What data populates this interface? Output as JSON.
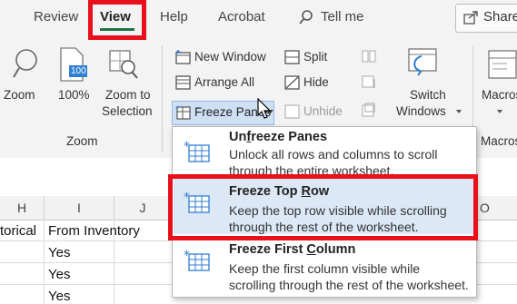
{
  "tabs": [
    {
      "label": "Review"
    },
    {
      "label": "View"
    },
    {
      "label": "Help"
    },
    {
      "label": "Acrobat"
    },
    {
      "label": "Tell me"
    }
  ],
  "share_label": "Share",
  "zoom_group": {
    "zoom": "Zoom",
    "hundred": "100%",
    "zoom_to_line1": "Zoom to",
    "zoom_to_line2": "Selection",
    "group_label": "Zoom",
    "icon_badge": "100"
  },
  "window_group": {
    "new_window": "New Window",
    "arrange_all": "Arrange All",
    "freeze_panes": "Freeze Panes",
    "split": "Split",
    "hide": "Hide",
    "unhide": "Unhide",
    "switch_line1": "Switch",
    "switch_line2": "Windows"
  },
  "macros": {
    "label": "Macros",
    "group_label": "Macros"
  },
  "columns": {
    "H": "H",
    "I": "I",
    "J": "J",
    "O": "O"
  },
  "cells": {
    "h_row1": "torical",
    "i_row1": "From Inventory",
    "yes1": "Yes",
    "yes2": "Yes",
    "yes3": "Yes"
  },
  "menu": {
    "items": [
      {
        "title_pre": "Un",
        "title_u": "f",
        "title_post": "reeze Panes",
        "desc1": "Unlock all rows and columns to scroll",
        "desc2": "through the entire worksheet."
      },
      {
        "title_pre": "Freeze Top ",
        "title_u": "R",
        "title_post": "ow",
        "desc1": "Keep the top row visible while scrolling",
        "desc2": "through the rest of the worksheet."
      },
      {
        "title_pre": "Freeze First ",
        "title_u": "C",
        "title_post": "olumn",
        "desc1": "Keep the first column visible while",
        "desc2": "scrolling through the rest of the worksheet."
      }
    ]
  },
  "colors": {
    "highlight": "#e8101b",
    "accent": "#217346",
    "icon_blue": "#2f7fd3"
  }
}
